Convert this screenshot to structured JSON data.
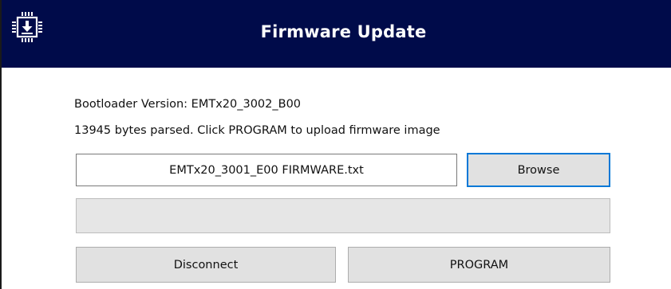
{
  "window": {
    "title": "Firmware Update",
    "icon": "chip-download-icon",
    "title_bar_color": "#000b4a"
  },
  "info": {
    "bootloader_version": "Bootloader Version: EMTx20_3002_B00",
    "status": "13945 bytes parsed. Click PROGRAM to upload firmware image"
  },
  "file": {
    "value": "EMTx20_3001_E00 FIRMWARE.txt"
  },
  "buttons": {
    "browse": "Browse",
    "disconnect": "Disconnect",
    "program": "PROGRAM"
  },
  "progress": {
    "fraction": 0
  },
  "colors": {
    "accent": "#0078d7",
    "button_face": "#e1e1e1"
  }
}
